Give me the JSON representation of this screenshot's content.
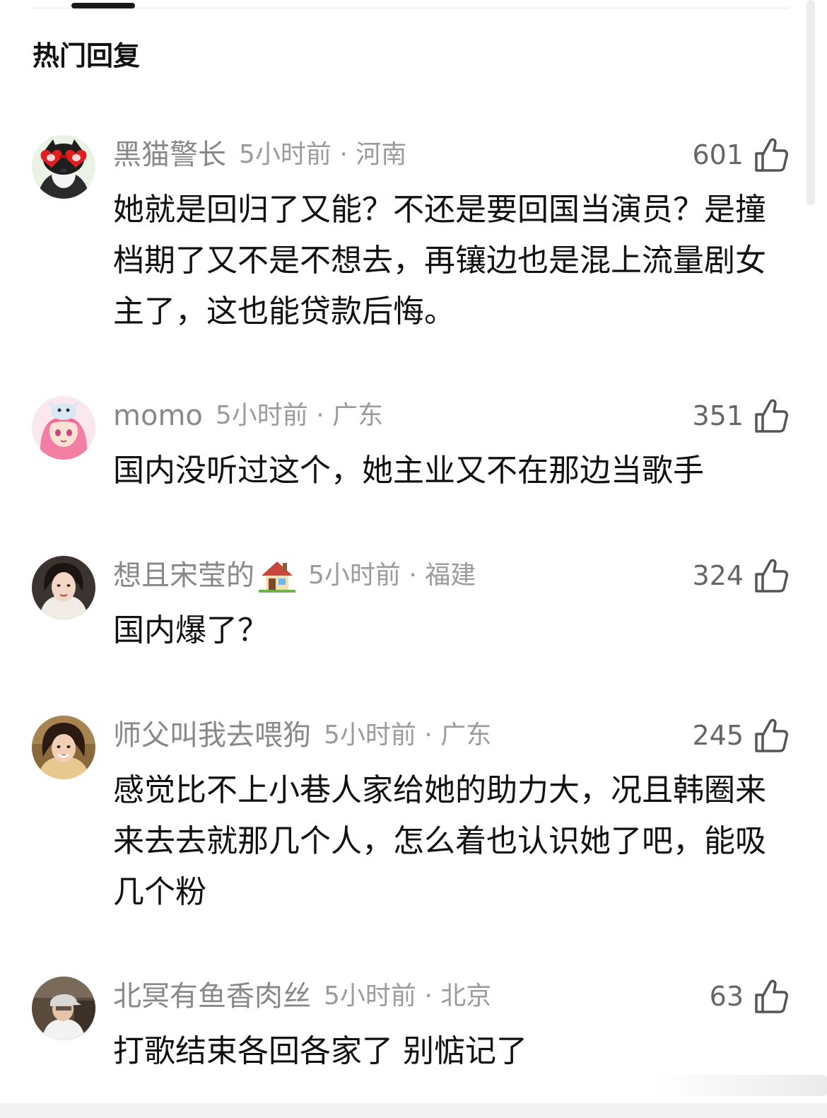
{
  "section": {
    "title": "热门回复"
  },
  "comments": [
    {
      "username": "黑猫警长",
      "time_location": "5小时前 · 河南",
      "likes": "601",
      "text": "她就是回归了又能？不还是要回国当演员？是撞档期了又不是不想去，再镶边也是混上流量剧女主了，这也能贷款后悔。",
      "avatar": "cat-with-heart-glasses"
    },
    {
      "username": "momo",
      "time_location": "5小时前 · 广东",
      "likes": "351",
      "text": "国内没听过这个，她主业又不在那边当歌手",
      "avatar": "anime-girl"
    },
    {
      "username": "想且宋莹的",
      "time_location": "5小时前 · 福建",
      "likes": "324",
      "text": "国内爆了？",
      "avatar": "woman-portrait",
      "name_emoji": "house-icon"
    },
    {
      "username": "师父叫我去喂狗",
      "time_location": "5小时前 · 广东",
      "likes": "245",
      "text": "感觉比不上小巷人家给她的助力大，况且韩圈来来去去就那几个人，怎么着也认识她了吧，能吸几个粉",
      "avatar": "smiling-woman"
    },
    {
      "username": "北冥有鱼香肉丝",
      "time_location": "5小时前 · 北京",
      "likes": "63",
      "text": "打歌结束各回各家了 别惦记了",
      "avatar": "person-with-cap"
    }
  ],
  "colors": {
    "username": "#888888",
    "meta": "#9b9b9b",
    "text": "#111111",
    "like_count": "#666666"
  }
}
